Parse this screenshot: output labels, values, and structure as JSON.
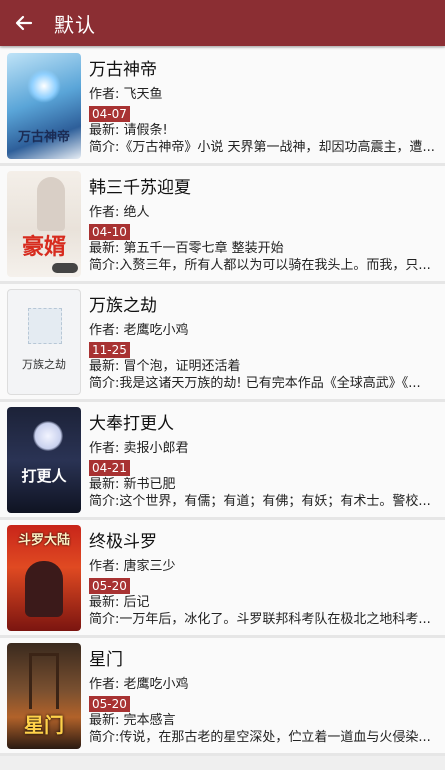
{
  "header": {
    "title": "默认",
    "back_icon": "arrow-left-icon"
  },
  "books": [
    {
      "title": "万古神帝",
      "author": "作者: 飞天鱼",
      "date": "04-07",
      "latest": "最新: 请假条!",
      "intro": "简介:《万古神帝》小说 天界第一战神，却因功高震主，遭..."
    },
    {
      "title": "韩三千苏迎夏",
      "author": "作者: 绝人",
      "date": "04-10",
      "latest": "最新: 第五千一百零七章 整装开始",
      "intro": "简介:入赘三年，所有人都以为可以骑在我头上。而我，只..."
    },
    {
      "title": "万族之劫",
      "author": "作者: 老鹰吃小鸡",
      "date": "11-25",
      "latest": "最新: 冒个泡，证明还活着",
      "intro": "简介:我是这诸天万族的劫! 已有完本作品《全球高武》《..."
    },
    {
      "title": "大奉打更人",
      "author": "作者: 卖报小郎君",
      "date": "04-21",
      "latest": "最新: 新书已肥",
      "intro": "简介:这个世界，有儒；有道；有佛；有妖；有术士。警校..."
    },
    {
      "title": "终极斗罗",
      "author": "作者: 唐家三少",
      "date": "05-20",
      "latest": "最新: 后记",
      "intro": "简介:一万年后，冰化了。斗罗联邦科考队在极北之地科考..."
    },
    {
      "title": "星门",
      "author": "作者: 老鹰吃小鸡",
      "date": "05-20",
      "latest": "最新: 完本感言",
      "intro": "简介:传说，在那古老的星空深处，伫立着一道血与火侵染..."
    }
  ],
  "covers": [
    {
      "text": "万古神帝"
    },
    {
      "text": "豪婿"
    },
    {
      "text": "万族之劫"
    },
    {
      "text": "打更人"
    },
    {
      "text": "斗罗大陆"
    },
    {
      "text": "星门"
    }
  ]
}
